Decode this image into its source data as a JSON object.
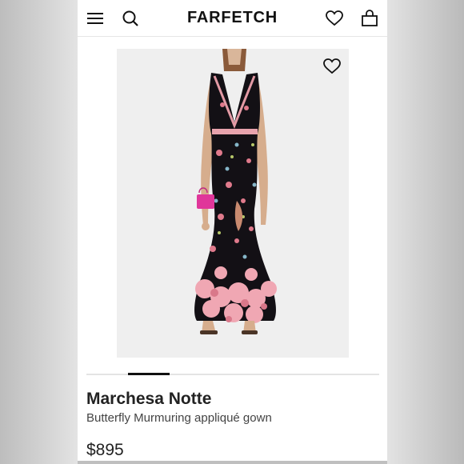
{
  "header": {
    "logo": "FARFETCH",
    "icons": [
      "menu-icon",
      "search-icon",
      "wishlist-icon",
      "bag-icon"
    ]
  },
  "product": {
    "brand": "Marchesa Notte",
    "name": "Butterfly Murmuring appliqué gown",
    "price": "$895",
    "image_icon": "dress-image",
    "gallery_active_index": 1,
    "gallery_count": 7
  },
  "colors": {
    "accent": "#111111",
    "dress": "#121014",
    "bag": "#e0369a"
  }
}
